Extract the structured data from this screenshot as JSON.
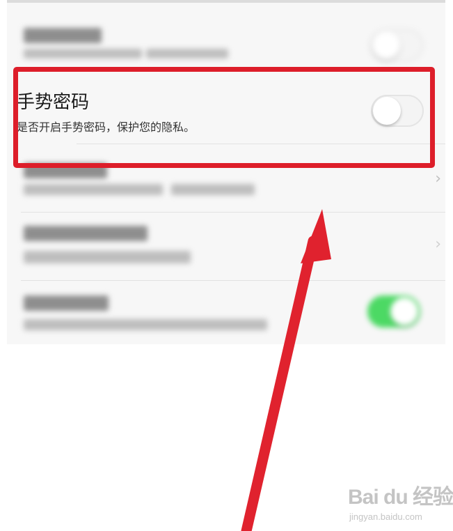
{
  "settings": {
    "gesture_password": {
      "title": "手势密码",
      "description": "是否开启手势密码，保护您的隐私。",
      "toggle_state": "off"
    },
    "blurred_rows": [
      {
        "control": "toggle",
        "state": "off"
      },
      {
        "control": "chevron"
      },
      {
        "control": "chevron"
      },
      {
        "control": "toggle",
        "state": "on"
      }
    ]
  },
  "annotation": {
    "highlight_color": "#dd1e2a",
    "arrow_color": "#e0222e"
  },
  "watermark": {
    "brand": "Bai du 经验",
    "url": "jingyan.baidu.com"
  }
}
